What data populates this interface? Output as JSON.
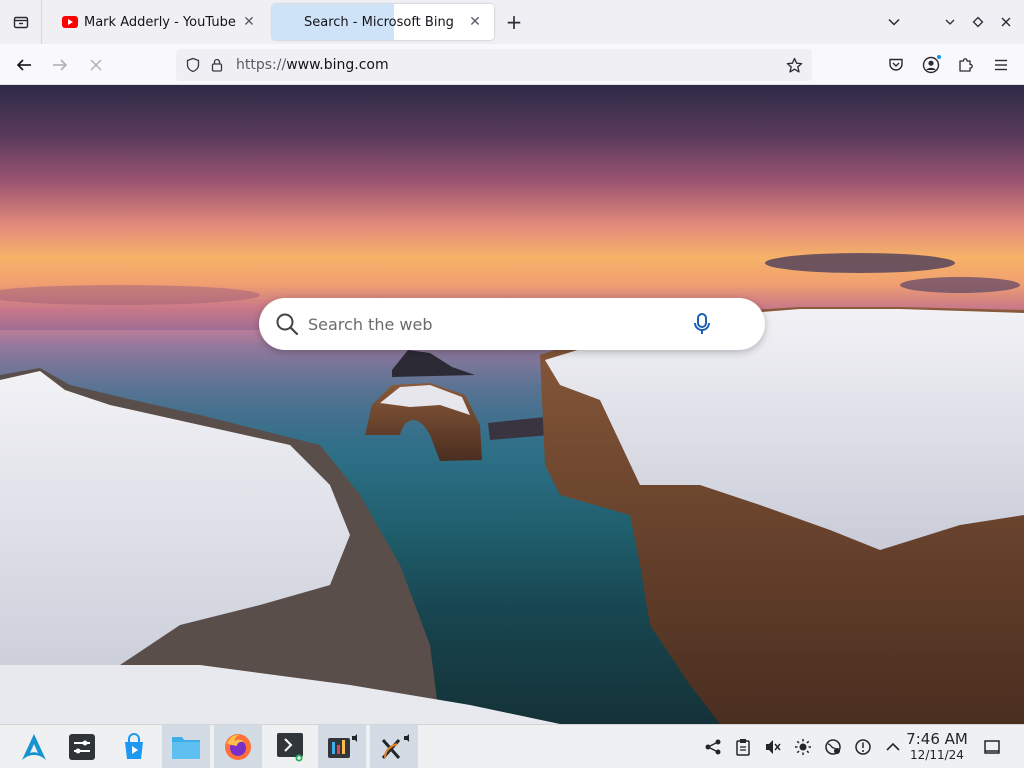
{
  "browser": {
    "tabs": [
      {
        "title": "Mark Adderly - YouTube",
        "icon": "youtube-icon",
        "active": false
      },
      {
        "title": "Search - Microsoft Bing",
        "icon": "none",
        "active": true
      }
    ],
    "new_tab_label": "+",
    "url": {
      "scheme": "https://",
      "host": "www.bing.com"
    }
  },
  "bing": {
    "search_placeholder": "Search the web"
  },
  "taskbar": {
    "apps": [
      {
        "name": "arch-linux-launcher-icon"
      },
      {
        "name": "system-settings-icon"
      },
      {
        "name": "discover-store-icon"
      },
      {
        "name": "file-manager-icon"
      },
      {
        "name": "firefox-icon"
      },
      {
        "name": "terminal-icon"
      },
      {
        "name": "media-app-icon"
      },
      {
        "name": "x-app-icon"
      }
    ],
    "clock": {
      "time": "7:46 AM",
      "date": "12/11/24"
    }
  },
  "colors": {
    "youtube_red": "#ff0000",
    "bing_blue": "#1e5fb4",
    "firefox_orange": "#ff7139",
    "tab_active_highlight": "#cfe3f8",
    "taskbar_bg": "#eff0f1",
    "arch_blue": "#1793d1"
  }
}
